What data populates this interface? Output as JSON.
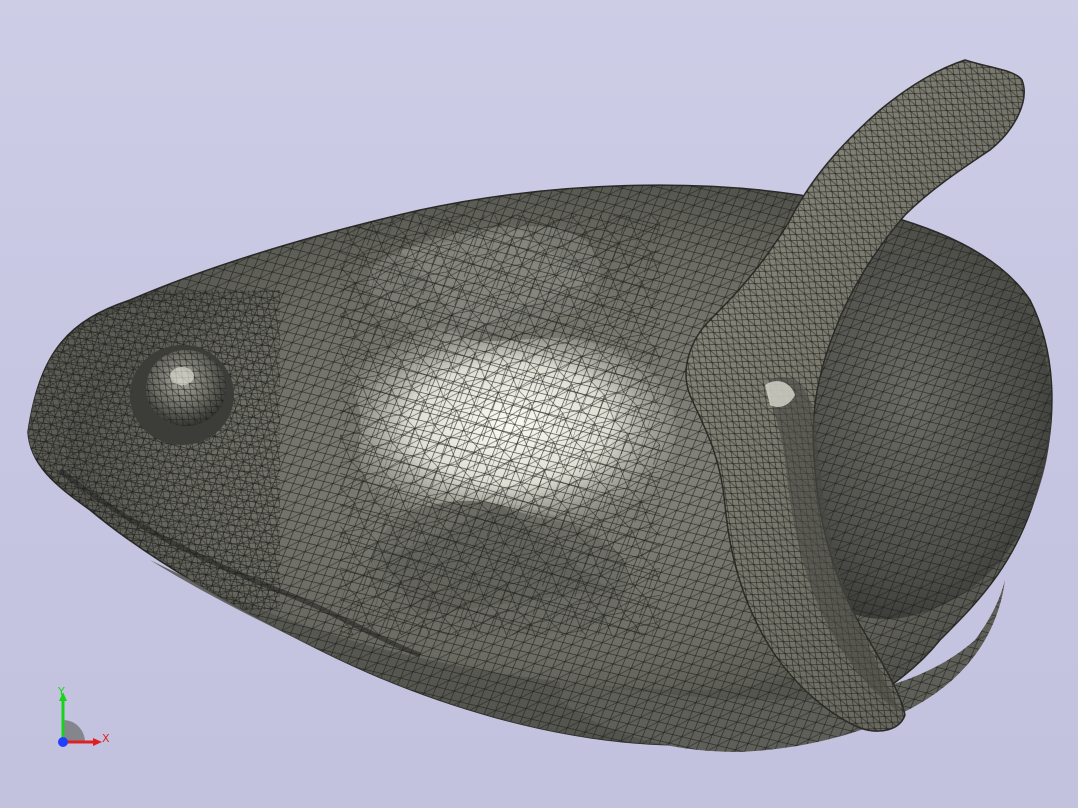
{
  "viewer": {
    "background_top": "#cdcde6",
    "background_bottom": "#c2c2df",
    "model": {
      "description_icon": "meshed-organic-head-model",
      "shading": "shaded-with-mesh-edges",
      "surface_color": "#7d7d72",
      "highlight_color": "#f4f4ea",
      "edge_color": "#1c1c1a"
    }
  },
  "axis_triad": {
    "x_label": "X",
    "y_label": "Y",
    "x_color": "#e02020",
    "y_color": "#19d319",
    "z_color": "#2040ff"
  }
}
